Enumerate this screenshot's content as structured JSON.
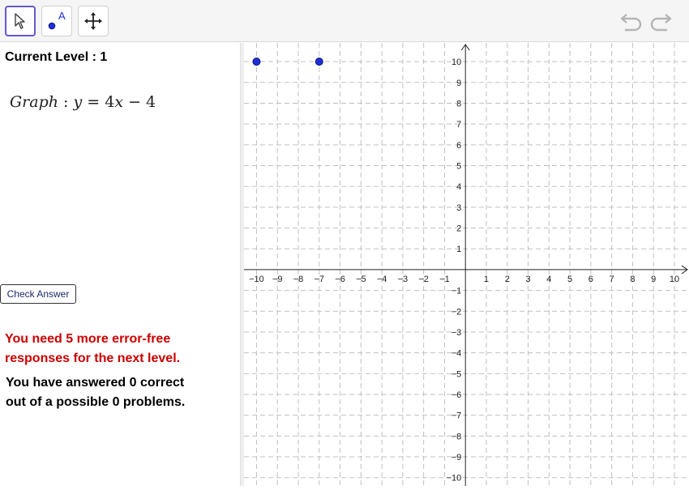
{
  "toolbar": {
    "tools": [
      {
        "name": "move-tool",
        "icon": "arrow-cursor-icon",
        "active": true
      },
      {
        "name": "point-tool",
        "icon": "point-a-icon",
        "label": "A",
        "active": false
      },
      {
        "name": "move-graphics-tool",
        "icon": "move-graphics-icon",
        "active": false
      }
    ],
    "undo_icon": "undo-icon",
    "redo_icon": "redo-icon"
  },
  "panel": {
    "level_text": "Current Level : 1",
    "equation": {
      "prefix": "Graph",
      "separator": " : ",
      "y": "y",
      "equals": " = ",
      "coef": "4",
      "x": "x",
      "minus": " − ",
      "const": "4"
    },
    "check_button": "Check Answer",
    "red_message_line1": "You need 5 more error-free",
    "red_message_line2": "responses for the next level.",
    "status_line1": "You have answered 0 correct",
    "status_line2": "out of a possible 0 problems."
  },
  "colors": {
    "accent": "#6557d2",
    "point": "#1f2fd6",
    "error_text": "#cc0000",
    "grid": "#c0c0c0"
  },
  "graph": {
    "x_ticks": [
      -10,
      -9,
      -8,
      -7,
      -6,
      -5,
      -4,
      -3,
      -2,
      -1,
      1,
      2,
      3,
      4,
      5,
      6,
      7,
      8,
      9,
      10
    ],
    "y_ticks": [
      10,
      9,
      8,
      7,
      6,
      5,
      4,
      3,
      2,
      1,
      -1,
      -2,
      -3,
      -4,
      -5,
      -6,
      -7,
      -8,
      -9,
      -10
    ],
    "x_range": [
      -10.6,
      10.7
    ],
    "y_range": [
      -10.4,
      10.9
    ],
    "points": [
      {
        "x": -10,
        "y": 10
      },
      {
        "x": -7,
        "y": 10
      }
    ],
    "grid": true
  }
}
